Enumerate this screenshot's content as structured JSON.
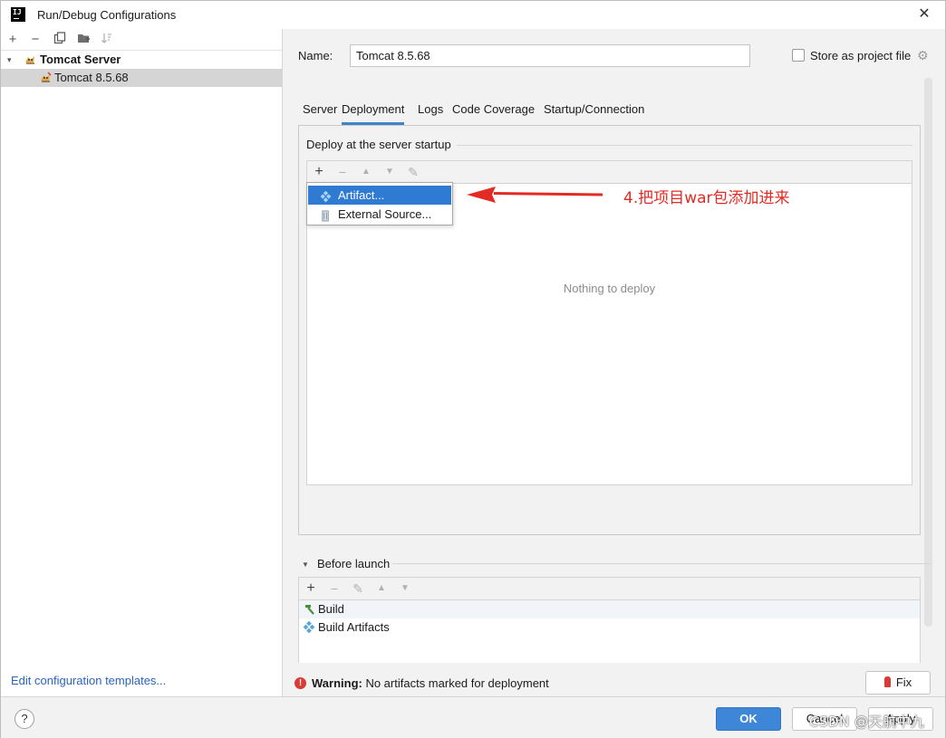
{
  "window": {
    "title": "Run/Debug Configurations",
    "close": "✕"
  },
  "left": {
    "toolbar": {
      "add": "+",
      "remove": "−"
    },
    "tree": {
      "group": {
        "arrow": "▾",
        "label": "Tomcat Server"
      },
      "item": {
        "label": "Tomcat 8.5.68"
      }
    },
    "edit_templates": "Edit configuration templates..."
  },
  "right": {
    "name_label": "Name:",
    "name_value": "Tomcat 8.5.68",
    "store_label": "Store as project file",
    "tabs": [
      "Server",
      "Deployment",
      "Logs",
      "Code Coverage",
      "Startup/Connection"
    ],
    "active_tab": "Deployment",
    "deploy": {
      "section_title": "Deploy at the server startup",
      "toolbar": {
        "add": "+",
        "remove": "−",
        "up": "▲",
        "down": "▼",
        "edit": "✎"
      },
      "empty_text": "Nothing to deploy",
      "popup": {
        "items": [
          "Artifact...",
          "External Source..."
        ],
        "selected_index": 0
      }
    },
    "annotation": "4.把项目war包添加进来",
    "before_launch": {
      "arrow": "▼",
      "title": "Before launch",
      "toolbar": {
        "add": "+",
        "remove": "−",
        "edit": "✎",
        "up": "▲",
        "down": "▼"
      },
      "items": [
        "Build",
        "Build Artifacts"
      ]
    },
    "warning": {
      "icon": "!",
      "bold": "Warning:",
      "text": " No artifacts marked for deployment"
    },
    "fix_label": "Fix"
  },
  "bottom": {
    "help": "?",
    "ok": "OK",
    "cancel": "Cancel",
    "apply": "Apply"
  },
  "watermark": "CSDN @天航中九",
  "colors": {
    "accent": "#2f7bd3",
    "primary_button": "#3d86d8",
    "link": "#2a64c0",
    "annotation": "#e32b24",
    "warning": "#d83a36"
  },
  "icons": {
    "app": "intellij-icon",
    "tomcat": "tomcat-icon",
    "artifact": "artifact-icon",
    "external": "external-source-icon",
    "build": "hammer-icon",
    "gear": "gear-icon"
  }
}
